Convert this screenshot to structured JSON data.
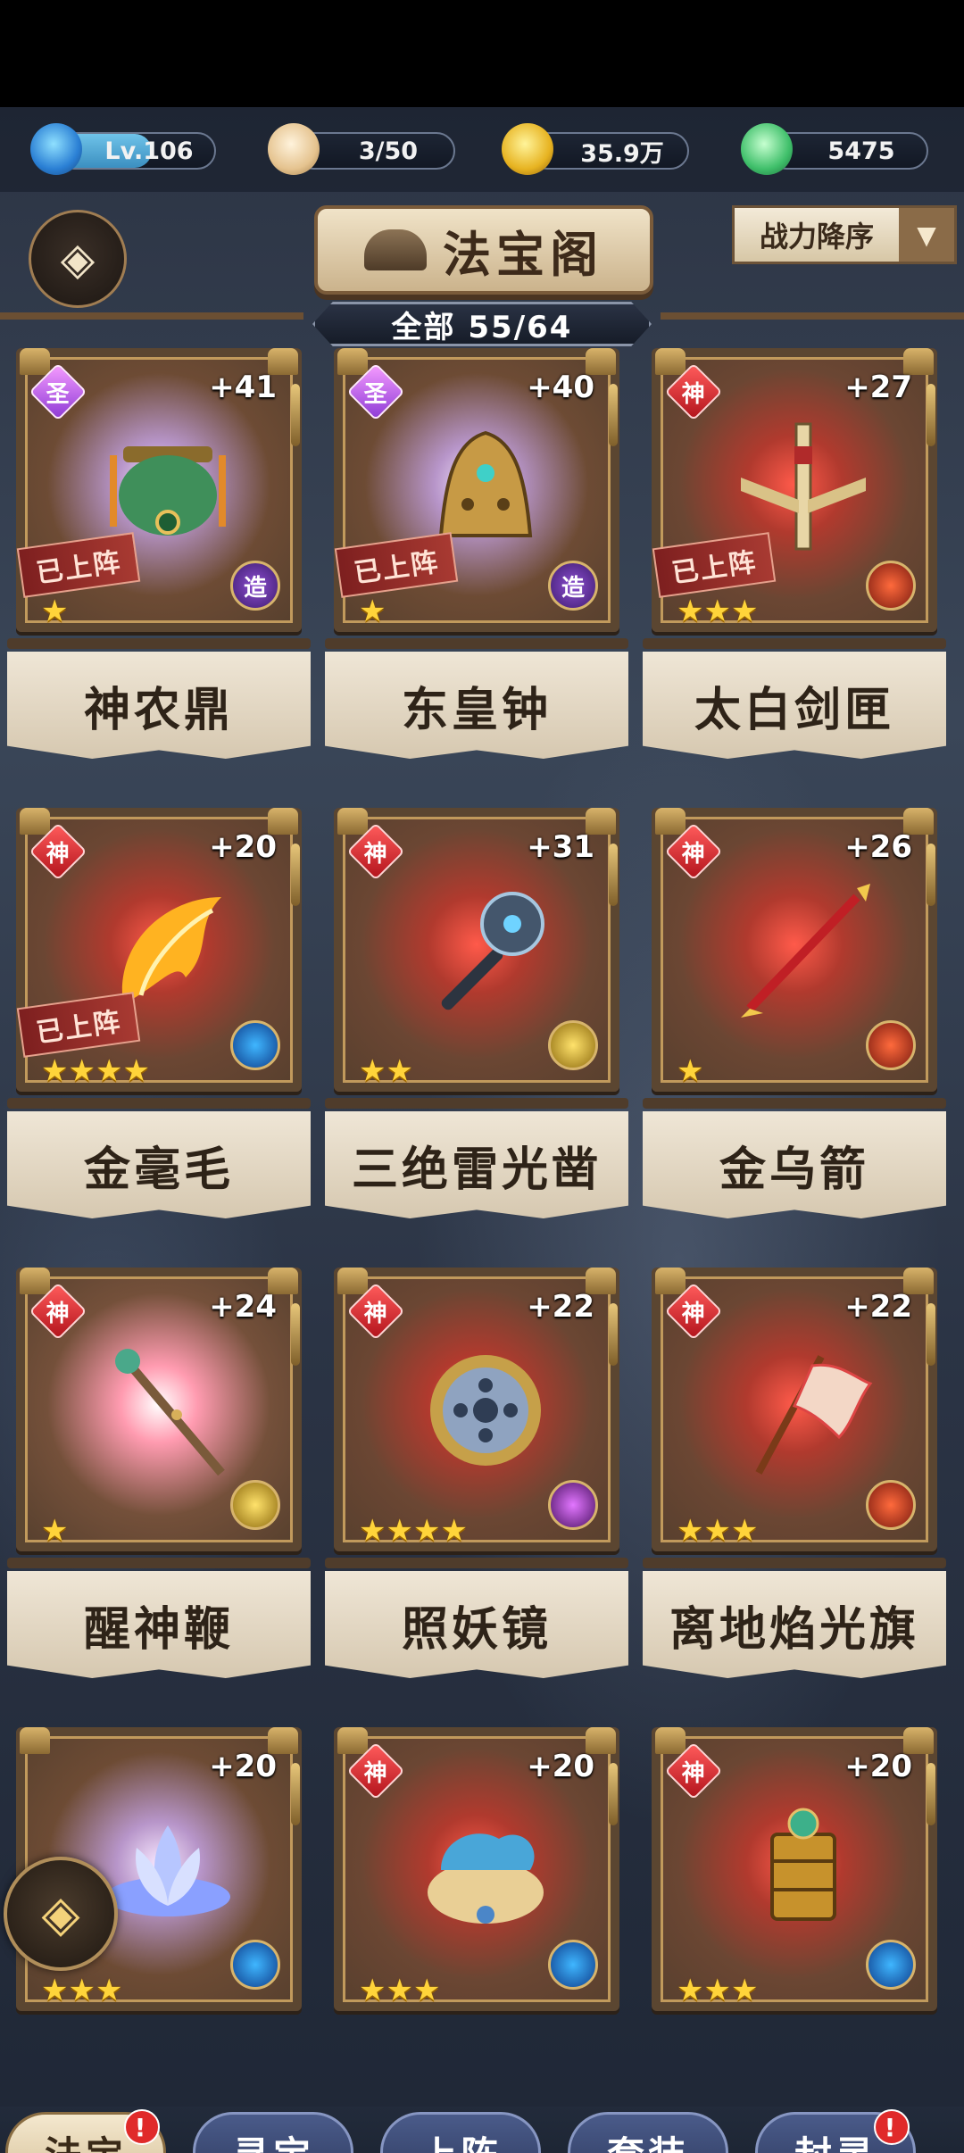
{
  "resources": {
    "level": "Lv.106",
    "level_progress": 0.6,
    "bun": "3/50",
    "coin": "35.9万",
    "jade": "5475"
  },
  "header": {
    "back_icon": "diamond-back-icon",
    "title": "法宝阁",
    "count": "全部 55/64",
    "sort_label": "战力降序",
    "sort_icon": "chevron-down-icon"
  },
  "items": [
    {
      "name": "神农鼎",
      "grade": "圣",
      "level": "+41",
      "stars": "★",
      "deployed": "已上阵",
      "element": "造",
      "element_kind": "zao",
      "glow": "sheng",
      "art": "green-cauldron",
      "color": "#3f8f5a"
    },
    {
      "name": "东皇钟",
      "grade": "圣",
      "level": "+40",
      "stars": "★",
      "deployed": "已上阵",
      "element": "造",
      "element_kind": "zao",
      "glow": "sheng",
      "art": "golden-bell",
      "color": "#c79a45"
    },
    {
      "name": "太白剑匣",
      "grade": "神",
      "level": "+27",
      "stars": "★★★",
      "deployed": "已上阵",
      "element": "",
      "element_kind": "fire",
      "glow": "shen",
      "art": "sword-case",
      "color": "#e8d6a6"
    },
    {
      "name": "金毫毛",
      "grade": "神",
      "level": "+20",
      "stars": "★★★★",
      "deployed": "已上阵",
      "element": "",
      "element_kind": "water",
      "glow": "shen",
      "art": "golden-feather",
      "color": "#ffb321"
    },
    {
      "name": "三绝雷光凿",
      "grade": "神",
      "level": "+31",
      "stars": "★★",
      "deployed": "",
      "element": "",
      "element_kind": "gold",
      "glow": "shen",
      "art": "thunder-hammer",
      "color": "#44566c"
    },
    {
      "name": "金乌箭",
      "grade": "神",
      "level": "+26",
      "stars": "★",
      "deployed": "",
      "element": "",
      "element_kind": "fire",
      "glow": "shen",
      "art": "red-arrow",
      "color": "#c01f25"
    },
    {
      "name": "醒神鞭",
      "grade": "神",
      "level": "+24",
      "stars": "★",
      "deployed": "",
      "element": "",
      "element_kind": "gold",
      "glow": "shen-green",
      "art": "whip-staff",
      "color": "#7a5a3a"
    },
    {
      "name": "照妖镜",
      "grade": "神",
      "level": "+22",
      "stars": "★★★★",
      "deployed": "",
      "element": "",
      "element_kind": "moon",
      "glow": "shen",
      "art": "round-mirror",
      "color": "#8fa3c0"
    },
    {
      "name": "离地焰光旗",
      "grade": "神",
      "level": "+22",
      "stars": "★★★",
      "deployed": "",
      "element": "",
      "element_kind": "fire",
      "glow": "shen",
      "art": "flame-flag",
      "color": "#f3d7c6"
    },
    {
      "name": "",
      "grade": "",
      "level": "+20",
      "stars": "★★★",
      "deployed": "",
      "element": "",
      "element_kind": "water",
      "glow": "sheng",
      "art": "lotus",
      "color": "#b7c6ff"
    },
    {
      "name": "",
      "grade": "神",
      "level": "+20",
      "stars": "★★★",
      "deployed": "",
      "element": "",
      "element_kind": "water",
      "glow": "shen",
      "art": "cloud-bowl",
      "color": "#49a6d8"
    },
    {
      "name": "",
      "grade": "神",
      "level": "+20",
      "stars": "★★★",
      "deployed": "",
      "element": "",
      "element_kind": "water",
      "glow": "shen",
      "art": "golden-lantern",
      "color": "#c7922c"
    }
  ],
  "float_icon": "diamond-menu-icon",
  "tabs": [
    {
      "label": "法宝",
      "badge": "!",
      "active": true
    },
    {
      "label": "寻宝",
      "badge": "",
      "active": false
    },
    {
      "label": "上阵",
      "badge": "",
      "active": false
    },
    {
      "label": "套装",
      "badge": "",
      "active": false
    },
    {
      "label": "封灵",
      "badge": "!",
      "active": false
    }
  ]
}
